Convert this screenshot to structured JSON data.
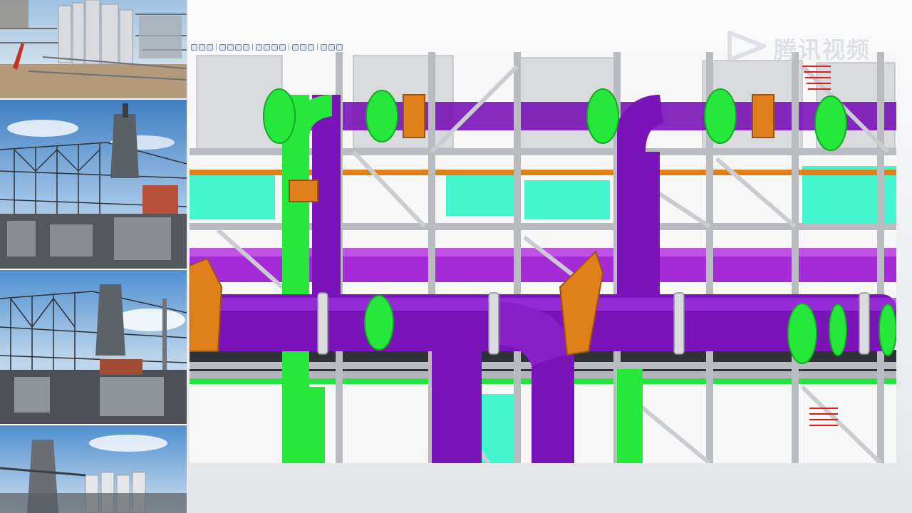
{
  "left_strip": {
    "photos": [
      {
        "name": "refinery-site-photo",
        "icon": "construction-site"
      },
      {
        "name": "steel-plant-photo-1",
        "icon": "blast-furnace"
      },
      {
        "name": "steel-plant-photo-2",
        "icon": "blast-furnace"
      },
      {
        "name": "steel-plant-photo-3",
        "icon": "blast-furnace"
      }
    ]
  },
  "viewer": {
    "toolbar": {
      "icons": [
        "select-icon",
        "pan-icon",
        "rotate-icon",
        "zoom-in-icon",
        "zoom-out-icon",
        "zoom-window-icon",
        "fit-icon",
        "view-front-icon",
        "view-top-icon",
        "view-iso-icon",
        "render-icon",
        "section-icon",
        "measure-icon",
        "layer-icon",
        "hide-icon",
        "settings-icon",
        "help-icon"
      ]
    },
    "model": {
      "description_colors": {
        "pipe": "#7a13b8",
        "pipe_highlight": "#a233e2",
        "flange_green": "#25e83a",
        "flange_orange": "#e0801a",
        "steel": "#c9ccd1",
        "cyan": "#2ff5c8",
        "red": "#e21a1a"
      }
    }
  },
  "watermark": {
    "text": "腾讯视频",
    "icon": "play-logo-icon"
  }
}
